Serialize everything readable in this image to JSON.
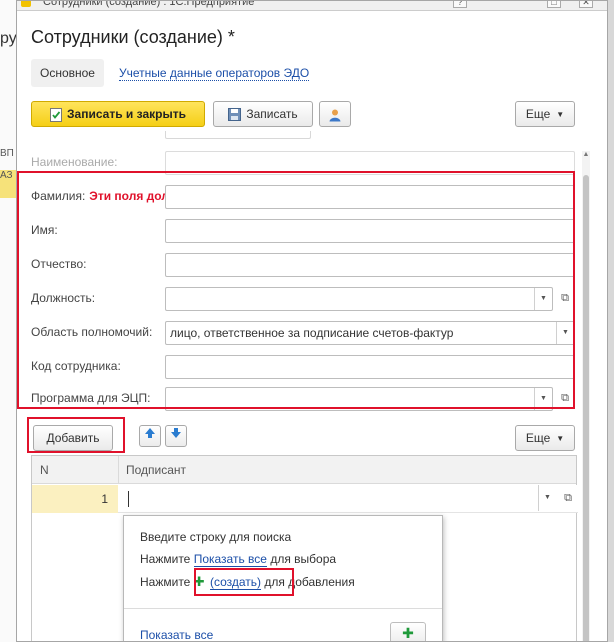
{
  "window": {
    "title_text": "Сотрудники (создание) : 1С:Предприятие",
    "buttons": [
      "?",
      "□",
      "✕"
    ]
  },
  "background": {
    "frag_1": "ру",
    "frag_2": "ВП",
    "frag_3": "АЗ"
  },
  "form": {
    "title": "Сотрудники (создание) *",
    "tabs": {
      "main": "Основное",
      "edo": "Учетные данные операторов ЭДО"
    }
  },
  "toolbar": {
    "save_close": "Записать и закрыть",
    "save": "Записать",
    "more": "Еще"
  },
  "fields": {
    "name_label": "Наименование:",
    "last_name_label": "Фамилия:",
    "warning_text": "Эти поля должныбыть заполнены",
    "first_name_label": "Имя:",
    "middle_name_label": "Отчество:",
    "position_label": "Должность:",
    "scope_label": "Область полномочий:",
    "scope_value": "лицо, ответственное за подписание счетов-фактур",
    "code_label": "Код сотрудника:",
    "program_label": "Программа для ЭЦП:"
  },
  "table_toolbar": {
    "add": "Добавить",
    "more": "Еще"
  },
  "grid": {
    "columns": [
      "N",
      "Подписант"
    ],
    "rows": [
      {
        "n": "1",
        "signer": ""
      }
    ]
  },
  "popup": {
    "line1": "Введите строку для поиска",
    "line2_prefix": "Нажмите",
    "line2_link": "Показать все",
    "line2_suffix": "для выбора",
    "line3_prefix": "Нажмите",
    "line3_link": "(создать)",
    "line3_suffix": "для добавления",
    "show_all": "Показать все"
  },
  "colors": {
    "accent_yellow": "#f5cf16",
    "highlight_red": "#e0112b",
    "link_blue": "#1c4fa8",
    "plus_green": "#1f9a3a"
  }
}
